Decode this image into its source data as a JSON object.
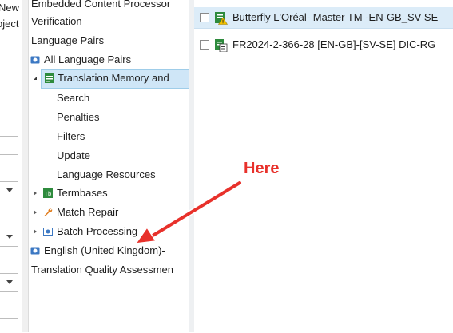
{
  "left_panel": {
    "clipped_labels": [
      "New",
      "oject"
    ]
  },
  "tree": {
    "items": [
      {
        "label": "Embedded Content Processor"
      },
      {
        "label": "Verification"
      },
      {
        "label": "Language Pairs"
      },
      {
        "label": "All Language Pairs"
      },
      {
        "label": "Translation Memory and"
      },
      {
        "label": "Search"
      },
      {
        "label": "Penalties"
      },
      {
        "label": "Filters"
      },
      {
        "label": "Update"
      },
      {
        "label": "Language Resources"
      },
      {
        "label": "Termbases"
      },
      {
        "label": "Match Repair"
      },
      {
        "label": "Batch Processing"
      },
      {
        "label": "English (United Kingdom)-"
      },
      {
        "label": "Translation Quality Assessmen"
      }
    ]
  },
  "list": {
    "rows": [
      {
        "name": "Butterfly L'Oréal- Master TM -EN-GB_SV-SE"
      },
      {
        "name": "FR2024-2-366-28  [EN-GB]-[SV-SE]  DIC-RG"
      }
    ]
  },
  "annotation": {
    "label": "Here",
    "color": "#e8312b"
  }
}
